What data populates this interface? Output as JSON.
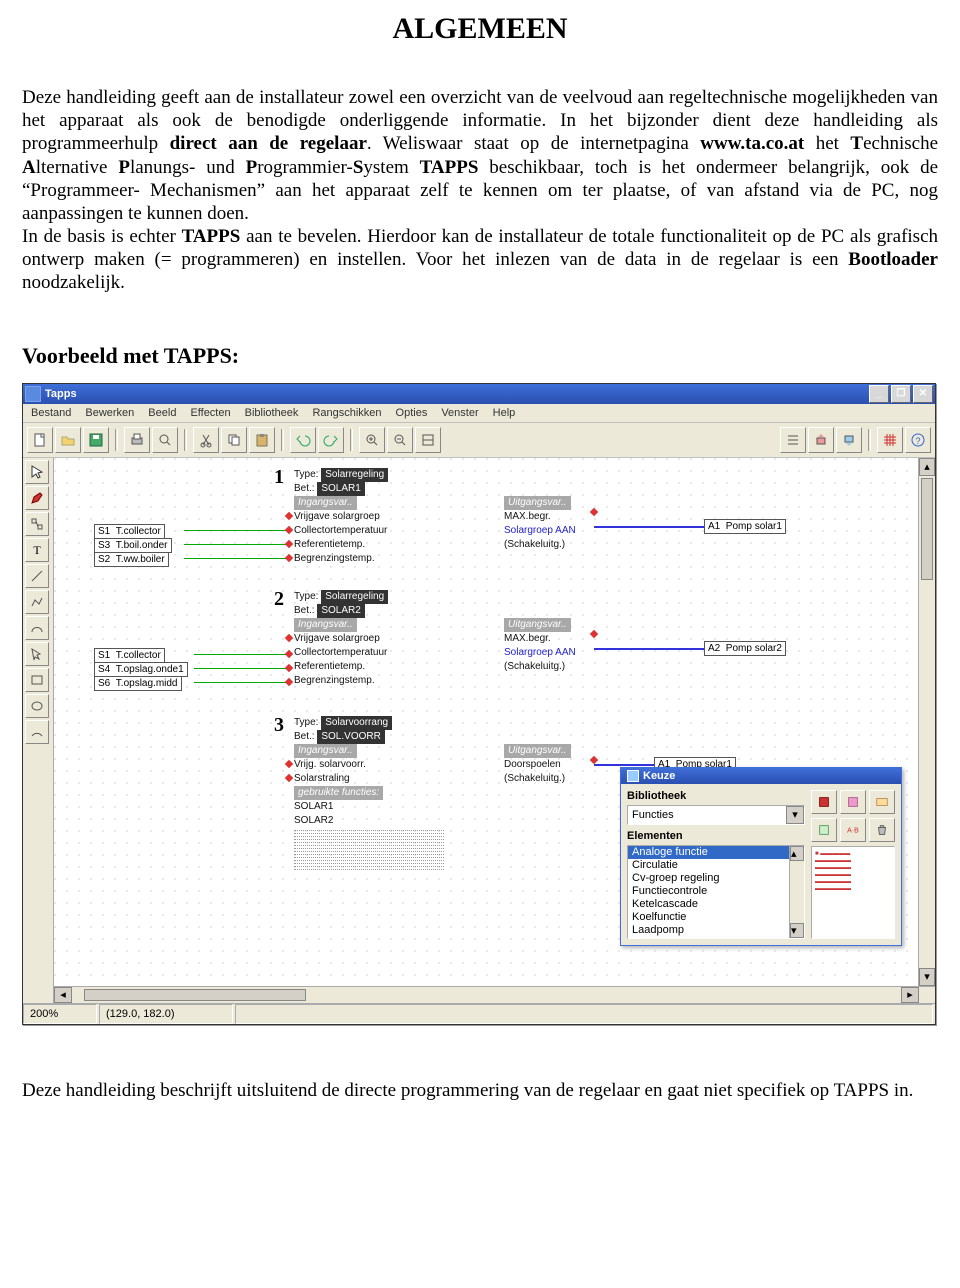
{
  "doc": {
    "title": "ALGEMEEN",
    "para1": "Deze handleiding geeft aan de installateur zowel een overzicht van de veelvoud aan regeltechnische mogelijkheden van het apparaat als ook de benodigde onderliggende informatie. In het bijzonder dient deze handleiding als programmeerhulp ",
    "para1b_bold": "direct aan de regelaar",
    "para1c": ". Weliswaar staat op de internetpagina ",
    "para1d_bold": "www.ta.co.at",
    "para1e": " het ",
    "para1f_bold": "T",
    "para1g": "echnische ",
    "para1h_bold": "A",
    "para1i": "lternative ",
    "para1j_bold": "P",
    "para1k": "lanungs- und ",
    "para1l_bold": "P",
    "para1m": "rogrammier-",
    "para1n_bold": "S",
    "para1o": "ystem ",
    "para1p_bold": "TAPPS",
    "para1q": " beschikbaar, toch is het ondermeer belangrijk, ook de “Programmeer- Mechanismen” aan het apparaat zelf te kennen om ter plaatse, of van afstand via de PC, nog aanpassingen te kunnen doen.",
    "para2a": "In de basis is echter ",
    "para2b_bold": "TAPPS",
    "para2c": " aan te bevelen. Hierdoor kan de installateur de totale functionaliteit op de PC als grafisch ontwerp maken (= programmeren) en instellen. Voor het inlezen van de data in de regelaar is een ",
    "para2d_bold": "Bootloader",
    "para2e": " noodzakelijk.",
    "section_h": "Voorbeeld met TAPPS:",
    "closing": "Deze handleiding beschrijft uitsluitend de directe programmering van de regelaar en gaat niet specifiek op TAPPS in."
  },
  "app": {
    "title": "Tapps",
    "winbuttons": {
      "min": "_",
      "max": "❐",
      "close": "✕"
    },
    "menus": [
      "Bestand",
      "Bewerken",
      "Beeld",
      "Effecten",
      "Bibliotheek",
      "Rangschikken",
      "Opties",
      "Venster",
      "Help"
    ],
    "status": {
      "zoom": "200%",
      "coords": "(129.0, 182.0)"
    }
  },
  "canvas": {
    "blocks": [
      {
        "num": "1",
        "type_key": "Type:",
        "type_val": "Solarregeling",
        "bet_key": "Bet.:",
        "bet_val": "SOLAR1",
        "in_hdr": "Ingangsvar..",
        "out_hdr": "Uitgangsvar..",
        "in_lines": [
          "Vrijgave solargroep",
          "Collectortemperatuur",
          "Referentietemp.",
          "Begrenzingstemp."
        ],
        "out_lines": [
          "MAX.begr.",
          "Solargroep AAN",
          "(Schakeluitg.)"
        ],
        "sensors": [
          {
            "id": "S1",
            "label": "T.collector"
          },
          {
            "id": "S3",
            "label": "T.boil.onder"
          },
          {
            "id": "S2",
            "label": "T.ww.boiler"
          }
        ],
        "out_tag": {
          "id": "A1",
          "label": "Pomp solar1"
        }
      },
      {
        "num": "2",
        "type_key": "Type:",
        "type_val": "Solarregeling",
        "bet_key": "Bet.:",
        "bet_val": "SOLAR2",
        "in_hdr": "Ingangsvar..",
        "out_hdr": "Uitgangsvar..",
        "in_lines": [
          "Vrijgave solargroep",
          "Collectortemperatuur",
          "Referentietemp.",
          "Begrenzingstemp."
        ],
        "out_lines": [
          "MAX.begr.",
          "Solargroep AAN",
          "(Schakeluitg.)"
        ],
        "sensors": [
          {
            "id": "S1",
            "label": "T.collector"
          },
          {
            "id": "S4",
            "label": "T.opslag.onde1"
          },
          {
            "id": "S6",
            "label": "T.opslag.midd"
          }
        ],
        "out_tag": {
          "id": "A2",
          "label": "Pomp solar2"
        }
      },
      {
        "num": "3",
        "type_key": "Type:",
        "type_val": "Solarvoorrang",
        "bet_key": "Bet.:",
        "bet_val": "SOL.VOORR",
        "in_hdr": "Ingangsvar..",
        "out_hdr": "Uitgangsvar..",
        "in_lines": [
          "Vrijg. solarvoorr.",
          "Solarstraling"
        ],
        "used_hdr": "gebruikte functies:",
        "used_lines": [
          "SOLAR1",
          "SOLAR2"
        ],
        "out_lines": [
          "Doorspoelen",
          "(Schakeluitg.)"
        ],
        "out_tag": {
          "id": "A1",
          "label": "Pomp solar1"
        }
      }
    ]
  },
  "keuze": {
    "title": "Keuze",
    "bib_label": "Bibliotheek",
    "bib_value": "Functies",
    "ele_label": "Elementen",
    "list": [
      "Analoge functie",
      "Circulatie",
      "Cv-groep regeling",
      "Functiecontrole",
      "Ketelcascade",
      "Koelfunctie",
      "Laadpomp"
    ],
    "selected_index": 0
  }
}
